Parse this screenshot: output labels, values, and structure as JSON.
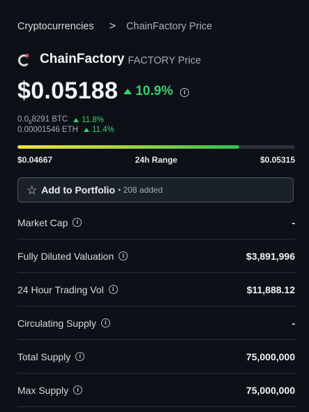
{
  "breadcrumb": {
    "parent": "Cryptocurrencies",
    "separator": ">",
    "current": "ChainFactory Price"
  },
  "coin": {
    "name": "ChainFactory",
    "symbol_label": "FACTORY Price",
    "logo_icon": "chainfactory-logo",
    "accent_color": "#e8586a"
  },
  "price": {
    "value": "$0.05188",
    "change": "10.9%",
    "info_icon": "info-icon"
  },
  "conversions": {
    "btc": {
      "prefix": "0.0",
      "subscript": "6",
      "rest": "8291 BTC",
      "change": "11.8%"
    },
    "eth": {
      "value": "0.00001546 ETH",
      "change": "11.4%"
    }
  },
  "range": {
    "low": "$0.04667",
    "label": "24h Range",
    "high": "$0.05315",
    "position_fraction": 0.8
  },
  "portfolio": {
    "label": "Add to Portfolio",
    "count": "• 208 added",
    "icon": "star-icon"
  },
  "stats": [
    {
      "label": "Market Cap",
      "value": "-"
    },
    {
      "label": "Fully Diluted Valuation",
      "value": "$3,891,996"
    },
    {
      "label": "24 Hour Trading Vol",
      "value": "$11,888.12"
    },
    {
      "label": "Circulating Supply",
      "value": "-"
    },
    {
      "label": "Total Supply",
      "value": "75,000,000"
    },
    {
      "label": "Max Supply",
      "value": "75,000,000"
    }
  ],
  "colors": {
    "background": "#0d1117",
    "positive": "#39d06a",
    "text": "#e6e8ea",
    "muted": "#a6acb2"
  }
}
